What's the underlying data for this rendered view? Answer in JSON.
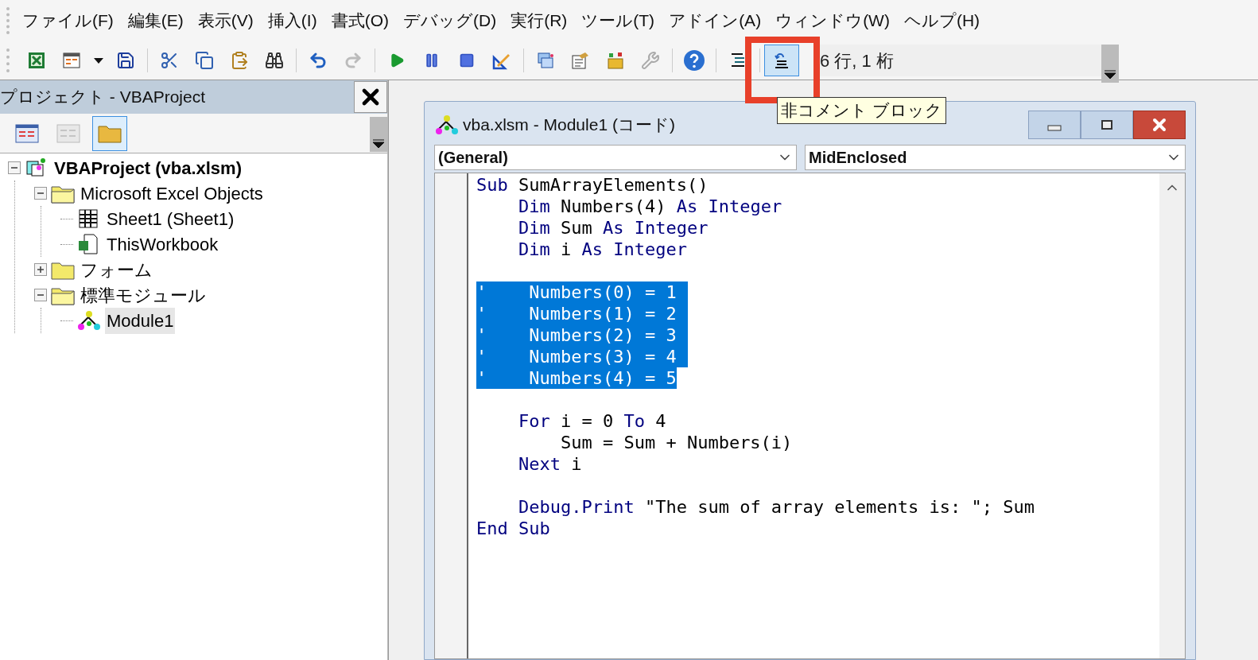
{
  "menu": [
    {
      "label": "ファイル(F)"
    },
    {
      "label": "編集(E)"
    },
    {
      "label": "表示(V)"
    },
    {
      "label": "挿入(I)"
    },
    {
      "label": "書式(O)"
    },
    {
      "label": "デバッグ(D)"
    },
    {
      "label": "実行(R)"
    },
    {
      "label": "ツール(T)"
    },
    {
      "label": "アドイン(A)"
    },
    {
      "label": "ウィンドウ(W)"
    },
    {
      "label": "ヘルプ(H)"
    }
  ],
  "toolbar": {
    "items": [
      {
        "kind": "excel",
        "hovered": false
      },
      {
        "kind": "form",
        "hovered": false
      },
      {
        "kind": "dropdown",
        "hovered": false
      },
      {
        "kind": "save",
        "hovered": false
      },
      {
        "kind": "separator"
      },
      {
        "kind": "cut",
        "hovered": false
      },
      {
        "kind": "copy",
        "hovered": false
      },
      {
        "kind": "paste",
        "hovered": false
      },
      {
        "kind": "find",
        "hovered": false
      },
      {
        "kind": "separator"
      },
      {
        "kind": "undo",
        "hovered": false
      },
      {
        "kind": "redo",
        "hovered": false
      },
      {
        "kind": "separator"
      },
      {
        "kind": "run",
        "hovered": false
      },
      {
        "kind": "pause",
        "hovered": false
      },
      {
        "kind": "stop",
        "hovered": false
      },
      {
        "kind": "design",
        "hovered": false
      },
      {
        "kind": "separator"
      },
      {
        "kind": "explorer",
        "hovered": false
      },
      {
        "kind": "properties",
        "hovered": false
      },
      {
        "kind": "toolbox",
        "hovered": false
      },
      {
        "kind": "tools",
        "hovered": false
      },
      {
        "kind": "separator"
      },
      {
        "kind": "help",
        "hovered": false
      },
      {
        "kind": "separator"
      },
      {
        "kind": "comment",
        "hovered": false
      },
      {
        "kind": "separator"
      },
      {
        "kind": "uncomment",
        "hovered": true,
        "annotated": true
      }
    ],
    "position": "6 行, 1 桁"
  },
  "tooltip": "非コメント ブロック",
  "project_panel": {
    "title": "プロジェクト - VBAProject",
    "buttons": [
      {
        "kind": "code",
        "disabled": false,
        "selected": false
      },
      {
        "kind": "object",
        "disabled": true,
        "selected": false
      },
      {
        "kind": "folders",
        "disabled": false,
        "selected": true
      }
    ],
    "tree": [
      {
        "label": "VBAProject (vba.xlsm)",
        "kind": "project",
        "expanded": true,
        "selected": false,
        "children": [
          {
            "label": "Microsoft Excel Objects",
            "kind": "folder",
            "expanded": true,
            "selected": false,
            "children": [
              {
                "label": "Sheet1 (Sheet1)",
                "kind": "sheet",
                "selected": false
              },
              {
                "label": "ThisWorkbook",
                "kind": "workbook",
                "selected": false
              }
            ]
          },
          {
            "label": "フォーム",
            "kind": "folder",
            "expanded": false,
            "selected": false
          },
          {
            "label": "標準モジュール",
            "kind": "folder",
            "expanded": true,
            "selected": false,
            "children": [
              {
                "label": "Module1",
                "kind": "module",
                "selected": true
              }
            ]
          }
        ]
      }
    ]
  },
  "code_window": {
    "title": "vba.xlsm - Module1 (コード)",
    "object_dropdown": "(General)",
    "procedure_dropdown": "MidEnclosed",
    "lines": [
      {
        "selected": false,
        "tokens": [
          {
            "text": "Sub",
            "keyword": true
          },
          {
            "text": " SumArrayElements()",
            "keyword": false
          }
        ]
      },
      {
        "selected": false,
        "tokens": [
          {
            "text": "    Dim",
            "keyword": true
          },
          {
            "text": " Numbers(4) ",
            "keyword": false
          },
          {
            "text": "As Integer",
            "keyword": true
          }
        ]
      },
      {
        "selected": false,
        "tokens": [
          {
            "text": "    Dim",
            "keyword": true
          },
          {
            "text": " Sum ",
            "keyword": false
          },
          {
            "text": "As Integer",
            "keyword": true
          }
        ]
      },
      {
        "selected": false,
        "tokens": [
          {
            "text": "    Dim",
            "keyword": true
          },
          {
            "text": " i ",
            "keyword": false
          },
          {
            "text": "As Integer",
            "keyword": true
          }
        ]
      },
      {
        "selected": false
      },
      {
        "selected": true,
        "tokens": [
          {
            "text": "'    Numbers(0) = 1"
          }
        ]
      },
      {
        "selected": true,
        "tokens": [
          {
            "text": "'    Numbers(1) = 2"
          }
        ]
      },
      {
        "selected": true,
        "tokens": [
          {
            "text": "'    Numbers(2) = 3"
          }
        ]
      },
      {
        "selected": true,
        "tokens": [
          {
            "text": "'    Numbers(3) = 4"
          }
        ]
      },
      {
        "selected": true,
        "tokens": [
          {
            "text": "'    Numbers(4) = 5"
          }
        ]
      },
      {
        "selected": false
      },
      {
        "selected": false,
        "tokens": [
          {
            "text": "    For",
            "keyword": true
          },
          {
            "text": " i = 0 ",
            "keyword": false
          },
          {
            "text": "To",
            "keyword": true
          },
          {
            "text": " 4",
            "keyword": false
          }
        ]
      },
      {
        "selected": false,
        "tokens": [
          {
            "text": "        Sum = Sum + Numbers(i)",
            "keyword": false
          }
        ]
      },
      {
        "selected": false,
        "tokens": [
          {
            "text": "    Next",
            "keyword": true
          },
          {
            "text": " i",
            "keyword": false
          }
        ]
      },
      {
        "selected": false
      },
      {
        "selected": false,
        "tokens": [
          {
            "text": "    Debug.Print",
            "keyword": true
          },
          {
            "text": " \"The sum of array elements is: \"; Sum",
            "keyword": false
          }
        ]
      },
      {
        "selected": false,
        "tokens": [
          {
            "text": "End Sub",
            "keyword": true
          }
        ]
      }
    ]
  }
}
